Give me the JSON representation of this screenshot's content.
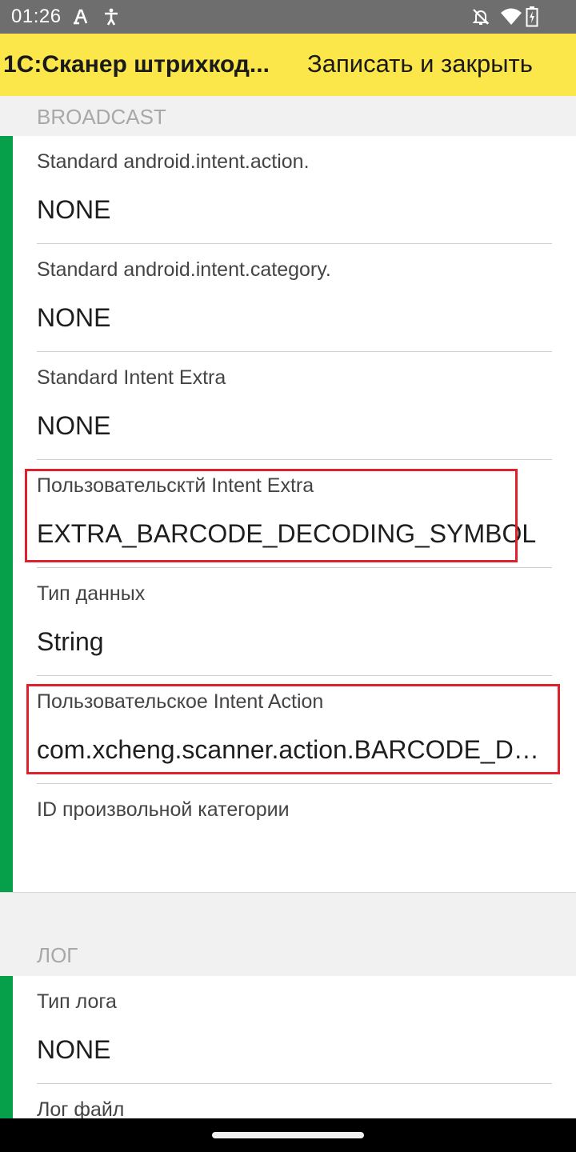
{
  "status_bar": {
    "time": "01:26",
    "icons": [
      "a-notification-icon",
      "accessibility-icon",
      "bell-off-icon",
      "wifi-icon",
      "battery-charging-icon"
    ]
  },
  "app_bar": {
    "title": "1С:Сканер штрихкод...",
    "save_close": "Записать и закрыть",
    "background": "#fbe74a"
  },
  "sections": {
    "broadcast": {
      "header": "BROADCAST",
      "fields": [
        {
          "label": "Standard android.intent.action.",
          "value": "NONE"
        },
        {
          "label": "Standard android.intent.category.",
          "value": "NONE"
        },
        {
          "label": "Standard Intent Extra",
          "value": "NONE"
        },
        {
          "label": "Пользовательсктй Intent Extra",
          "value": "EXTRA_BARCODE_DECODING_SYMBOL"
        },
        {
          "label": "Тип данных",
          "value": "String"
        },
        {
          "label": "Пользовательское Intent Action",
          "value": "com.xcheng.scanner.action.BARCODE_DE..."
        },
        {
          "label": "ID произвольной категории",
          "value": ""
        }
      ]
    },
    "log": {
      "header": "ЛОГ",
      "fields": [
        {
          "label": "Тип лога",
          "value": "NONE"
        },
        {
          "label": "Лог файл",
          "value": ""
        }
      ]
    }
  },
  "colors": {
    "accent_green": "#07a04a",
    "highlight_red": "#e0202c",
    "section_bg": "#f1f1f1"
  }
}
